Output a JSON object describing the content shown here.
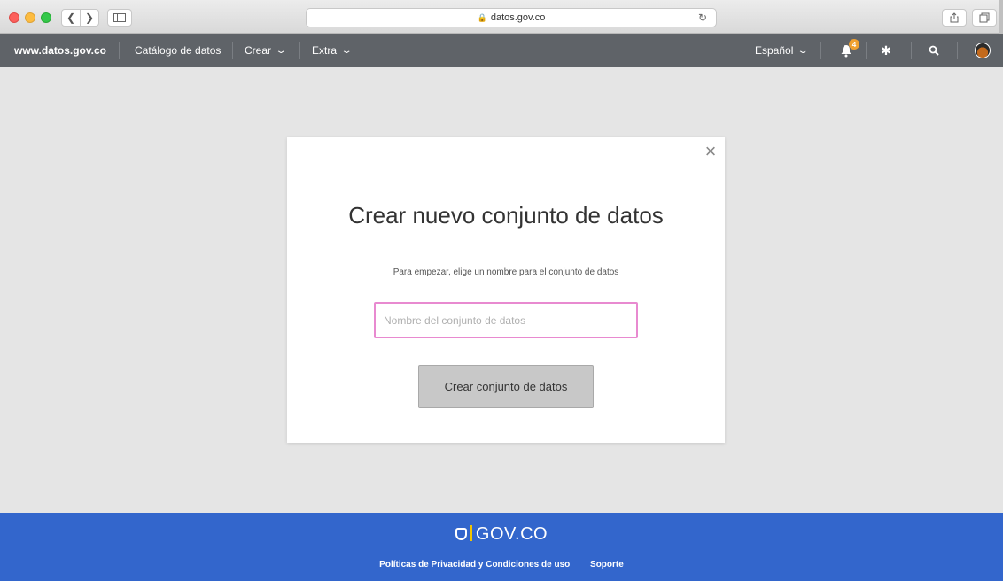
{
  "browser": {
    "url": "datos.gov.co"
  },
  "nav": {
    "site": "www.datos.gov.co",
    "catalog": "Catálogo de datos",
    "crear": "Crear",
    "extra": "Extra",
    "language": "Español",
    "notification_count": "4"
  },
  "modal": {
    "close_glyph": "×",
    "title": "Crear nuevo conjunto de datos",
    "subtitle": "Para empezar, elige un nombre para el conjunto de datos",
    "input_placeholder": "Nombre del conjunto de datos",
    "input_value": "",
    "create_button": "Crear conjunto de datos"
  },
  "footer": {
    "logo_text": "GOV.CO",
    "privacy_link": "Políticas de Privacidad y Condiciones de uso",
    "support_link": "Soporte"
  },
  "colors": {
    "nav_bg": "#5f6368",
    "footer_bg": "#3366cc",
    "input_focus_border": "#e88ad0",
    "badge": "#f0a030"
  },
  "icons": [
    "back-icon",
    "forward-icon",
    "sidebar-icon",
    "lock-icon",
    "reload-icon",
    "share-icon",
    "tabs-icon",
    "bell-icon",
    "gear-icon",
    "search-icon",
    "avatar",
    "close-icon",
    "shield-icon"
  ]
}
